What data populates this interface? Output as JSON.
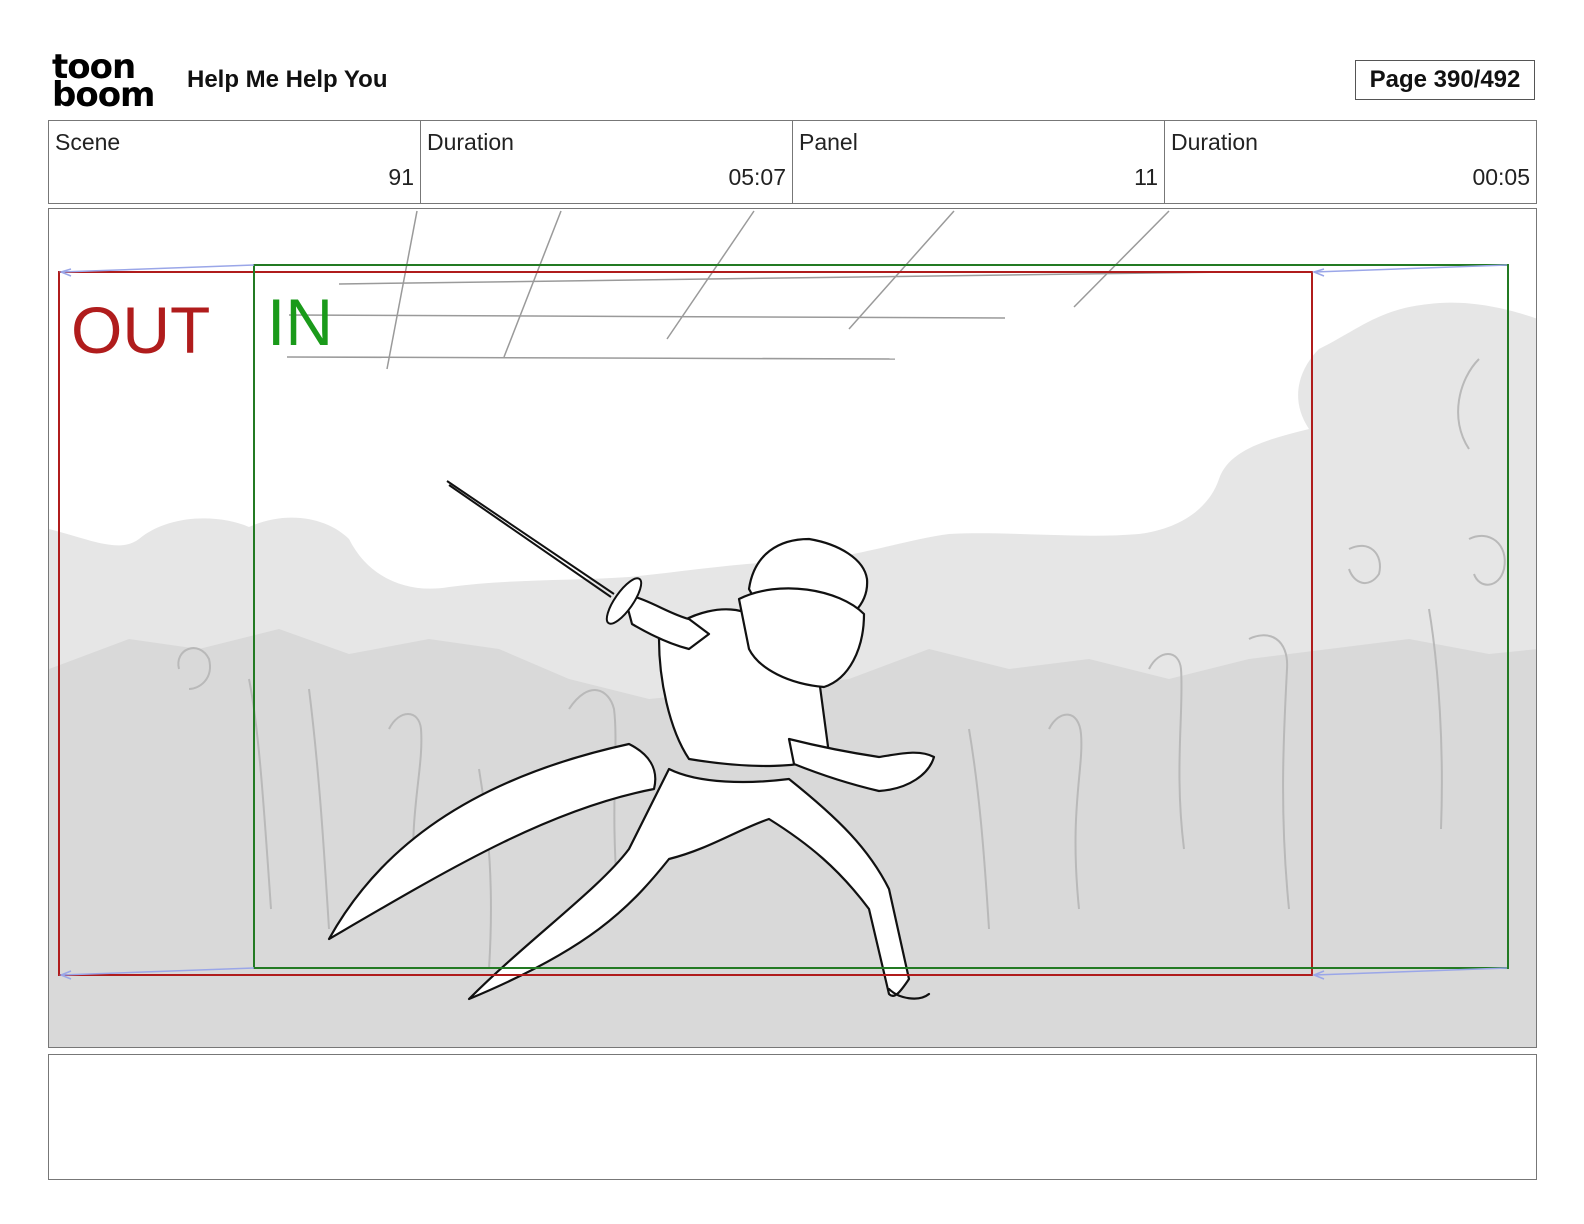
{
  "header": {
    "logo_top": "toon",
    "logo_bottom": "boom",
    "project_title": "Help Me Help You",
    "page_label": "Page 390/492"
  },
  "info": [
    {
      "label": "Scene",
      "value": "91"
    },
    {
      "label": "Duration",
      "value": "05:07"
    },
    {
      "label": "Panel",
      "value": "11"
    },
    {
      "label": "Duration",
      "value": "00:05"
    }
  ],
  "panel": {
    "out_label": "OUT",
    "in_label": "IN",
    "out_color": "#b01c1c",
    "in_color": "#1a9a1a"
  },
  "notes": {
    "text": ""
  }
}
